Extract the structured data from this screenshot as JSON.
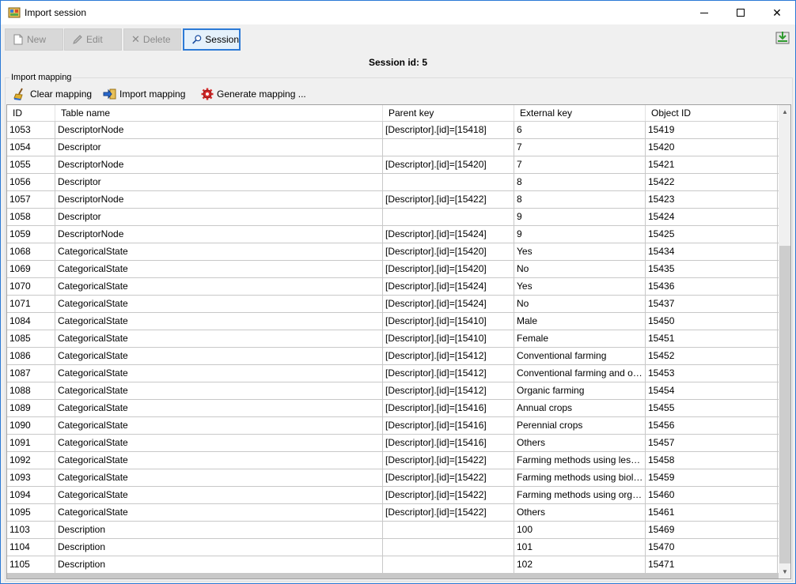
{
  "window": {
    "title": "Import session"
  },
  "toolbar": {
    "new_label": "New",
    "edit_label": "Edit",
    "delete_label": "Delete",
    "session_label": "Session"
  },
  "session": {
    "id_text": "Session id: 5"
  },
  "mapping": {
    "group_label": "Import mapping",
    "clear_label": "Clear mapping",
    "import_label": "Import mapping",
    "generate_label": "Generate mapping ..."
  },
  "table": {
    "columns": [
      "ID",
      "Table name",
      "Parent key",
      "External key",
      "Object ID"
    ],
    "rows": [
      [
        "1053",
        "DescriptorNode",
        "[Descriptor].[id]=[15418]",
        "6",
        "15419"
      ],
      [
        "1054",
        "Descriptor",
        "",
        "7",
        "15420"
      ],
      [
        "1055",
        "DescriptorNode",
        "[Descriptor].[id]=[15420]",
        "7",
        "15421"
      ],
      [
        "1056",
        "Descriptor",
        "",
        "8",
        "15422"
      ],
      [
        "1057",
        "DescriptorNode",
        "[Descriptor].[id]=[15422]",
        "8",
        "15423"
      ],
      [
        "1058",
        "Descriptor",
        "",
        "9",
        "15424"
      ],
      [
        "1059",
        "DescriptorNode",
        "[Descriptor].[id]=[15424]",
        "9",
        "15425"
      ],
      [
        "1068",
        "CategoricalState",
        "[Descriptor].[id]=[15420]",
        "Yes",
        "15434"
      ],
      [
        "1069",
        "CategoricalState",
        "[Descriptor].[id]=[15420]",
        "No",
        "15435"
      ],
      [
        "1070",
        "CategoricalState",
        "[Descriptor].[id]=[15424]",
        "Yes",
        "15436"
      ],
      [
        "1071",
        "CategoricalState",
        "[Descriptor].[id]=[15424]",
        "No",
        "15437"
      ],
      [
        "1084",
        "CategoricalState",
        "[Descriptor].[id]=[15410]",
        "Male",
        "15450"
      ],
      [
        "1085",
        "CategoricalState",
        "[Descriptor].[id]=[15410]",
        "Female",
        "15451"
      ],
      [
        "1086",
        "CategoricalState",
        "[Descriptor].[id]=[15412]",
        "Conventional farming",
        "15452"
      ],
      [
        "1087",
        "CategoricalState",
        "[Descriptor].[id]=[15412]",
        "Conventional farming and orga...",
        "15453"
      ],
      [
        "1088",
        "CategoricalState",
        "[Descriptor].[id]=[15412]",
        "Organic farming",
        "15454"
      ],
      [
        "1089",
        "CategoricalState",
        "[Descriptor].[id]=[15416]",
        "Annual crops",
        "15455"
      ],
      [
        "1090",
        "CategoricalState",
        "[Descriptor].[id]=[15416]",
        "Perennial crops",
        "15456"
      ],
      [
        "1091",
        "CategoricalState",
        "[Descriptor].[id]=[15416]",
        "Others",
        "15457"
      ],
      [
        "1092",
        "CategoricalState",
        "[Descriptor].[id]=[15422]",
        "Farming methods using less syn...",
        "15458"
      ],
      [
        "1093",
        "CategoricalState",
        "[Descriptor].[id]=[15422]",
        "Farming methods using biologic...",
        "15459"
      ],
      [
        "1094",
        "CategoricalState",
        "[Descriptor].[id]=[15422]",
        "Farming methods using organic ...",
        "15460"
      ],
      [
        "1095",
        "CategoricalState",
        "[Descriptor].[id]=[15422]",
        "Others",
        "15461"
      ],
      [
        "1103",
        "Description",
        "",
        "100",
        "15469"
      ],
      [
        "1104",
        "Description",
        "",
        "101",
        "15470"
      ],
      [
        "1105",
        "Description",
        "",
        "102",
        "15471"
      ]
    ]
  }
}
